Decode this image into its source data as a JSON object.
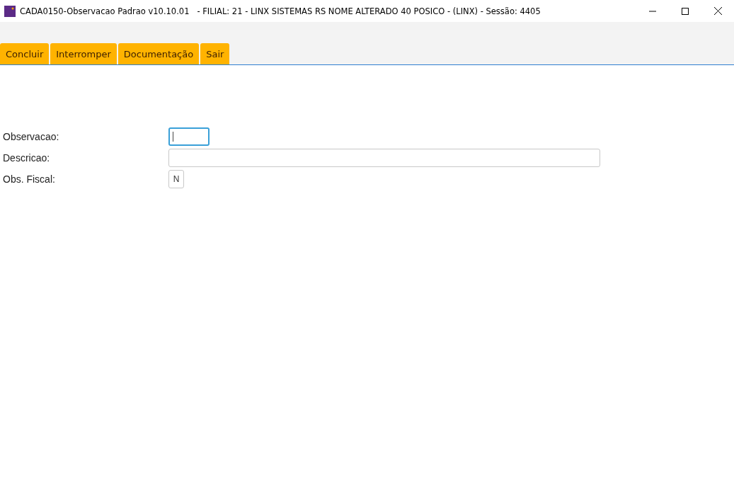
{
  "window": {
    "title": "CADA0150-Observacao Padrao v10.10.01   - FILIAL: 21 - LINX SISTEMAS RS NOME ALTERADO 40 POSICO - (LINX) - Sessão: 4405"
  },
  "toolbar": [
    {
      "label": "Concluir"
    },
    {
      "label": "Interromper"
    },
    {
      "label": "Documentação"
    },
    {
      "label": "Sair"
    }
  ],
  "form": [
    {
      "label": "Observacao:",
      "kind": "short",
      "focused": true
    },
    {
      "label": "Descricao:",
      "kind": "wide",
      "focused": false
    },
    {
      "label": "Obs. Fiscal:",
      "kind": "flag",
      "value": "N",
      "focused": false
    }
  ]
}
